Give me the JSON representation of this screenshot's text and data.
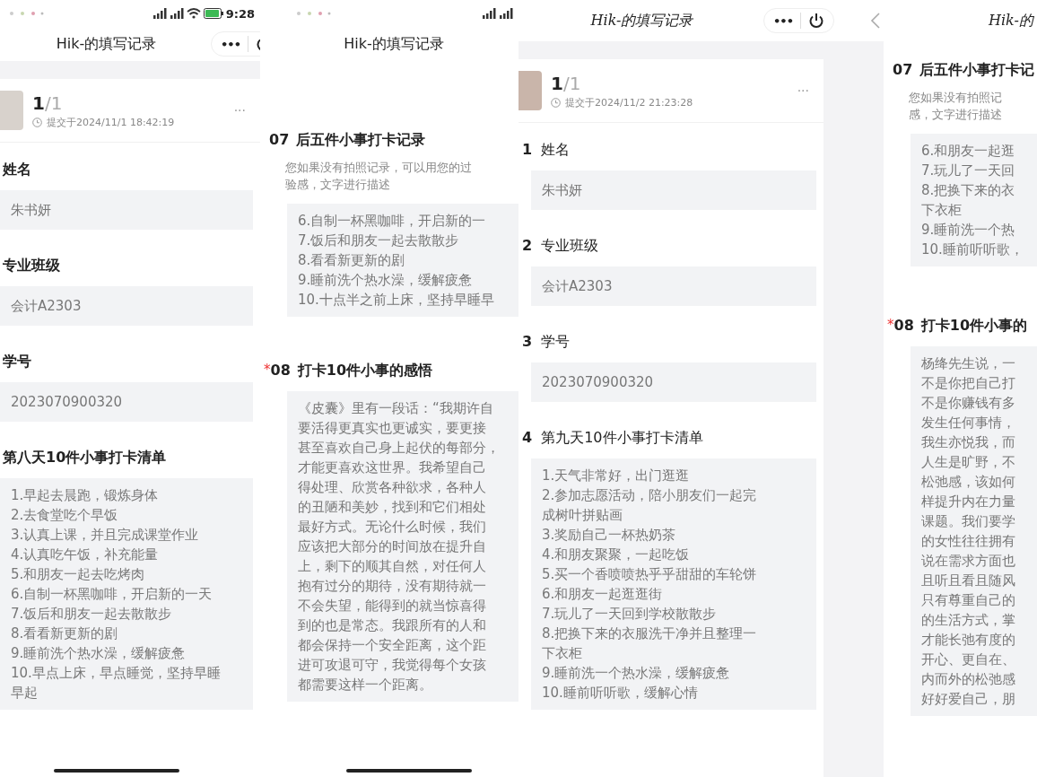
{
  "panels": [
    {
      "status_bar": {
        "kind": "full",
        "time": "9:28"
      },
      "nav": {
        "title": "Hik-的填写记录",
        "menu": "•••",
        "power": true
      },
      "header": {
        "index": "1",
        "total": "/1",
        "submitted": "提交于2024/11/1 18:42:19",
        "more": "···"
      },
      "home_indicator": true,
      "questions": [
        {
          "kind": "field",
          "label": "姓名",
          "answer": [
            "朱书妍"
          ]
        },
        {
          "kind": "field",
          "label": "专业班级",
          "answer": [
            "会计A2303"
          ]
        },
        {
          "kind": "field",
          "label": "学号",
          "answer": [
            "2023070900320"
          ]
        },
        {
          "kind": "list",
          "label": "第八天10件小事打卡清单",
          "answer": [
            "1.早起去晨跑，锻炼身体",
            "2.去食堂吃个早饭",
            "3.认真上课，并且完成课堂作业",
            "4.认真吃午饭，补充能量",
            "5.和朋友一起去吃烤肉",
            "6.自制一杯黑咖啡，开启新的一天",
            "7.饭后和朋友一起去散散步",
            "8.看看新更新的剧",
            "9.睡前洗个热水澡，缓解疲惫",
            "10.早点上床，早点睡觉，坚持早睡",
            "早起"
          ]
        }
      ]
    },
    {
      "status_bar": {
        "kind": "partial"
      },
      "nav": {
        "title": "Hik-的填写记录"
      },
      "home_indicator": true,
      "questions": [
        {
          "kind": "list",
          "number": "07",
          "label": "后五件小事打卡记录",
          "description": [
            "您如果没有拍照记录，可以用您的过",
            "验感，文字进行描述"
          ],
          "answer": [
            "6.自制一杯黑咖啡，开启新的一",
            "7.饭后和朋友一起去散散步",
            "8.看看新更新的剧",
            "9.睡前洗个热水澡，缓解疲惫",
            "10.十点半之前上床，坚持早睡早"
          ]
        },
        {
          "kind": "list",
          "mark": "*",
          "number": "08",
          "label": "打卡10件小事的感悟",
          "answer": [
            "《皮囊》里有一段话：“我期许自",
            "要活得更真实也更诚实，要更接",
            "甚至喜欢自己身上起伏的每部分，",
            "才能更喜欢这世界。我希望自己",
            "得处理、欣赏各种欲求，各种人",
            "的丑陋和美妙，找到和它们相处",
            "最好方式。无论什么时候，我们",
            "应该把大部分的时间放在提升自",
            "上，剩下的顺其自然，对任何人",
            "抱有过分的期待，没有期待就一",
            "不会失望，能得到的就当惊喜得",
            "到的也是常态。我跟所有的人和",
            "都会保持一个安全距离，这个距",
            "进可攻退可守，我觉得每个女孩",
            "都需要这样一个距离。"
          ]
        }
      ]
    },
    {
      "nav": {
        "title": "Hik-的填写记录",
        "menu": "•••",
        "power": true
      },
      "header": {
        "index": "1",
        "total": "/1",
        "submitted": "提交于2024/11/2 21:23:28",
        "more": "···"
      },
      "questions": [
        {
          "kind": "field",
          "number": "1",
          "label": "姓名",
          "answer": [
            "朱书妍"
          ]
        },
        {
          "kind": "field",
          "number": "2",
          "label": "专业班级",
          "answer": [
            "会计A2303"
          ]
        },
        {
          "kind": "field",
          "number": "3",
          "label": "学号",
          "answer": [
            "2023070900320"
          ]
        },
        {
          "kind": "list",
          "number": "4",
          "label": "第九天10件小事打卡清单",
          "answer": [
            "1.天气非常好，出门逛逛",
            "2.参加志愿活动，陪小朋友们一起完",
            "成树叶拼贴画",
            "3.奖励自己一杯热奶茶",
            "4.和朋友聚聚，一起吃饭",
            "5.买一个香喷喷热乎乎甜甜的车轮饼",
            "6.和朋友一起逛逛街",
            "7.玩儿了一天回到学校散散步",
            "8.把换下来的衣服洗干净并且整理一",
            "下衣柜",
            "9.睡前洗一个热水澡，缓解疲惫",
            "10.睡前听听歌，缓解心情"
          ]
        }
      ]
    },
    {
      "nav": {
        "back": true,
        "title": "Hik-的"
      },
      "questions": [
        {
          "kind": "list",
          "number": "07",
          "label": "后五件小事打卡记",
          "description": [
            "您如果没有拍照记",
            "感，文字进行描述"
          ],
          "answer": [
            "6.和朋友一起逛",
            "7.玩儿了一天回",
            "8.把换下来的衣",
            "下衣柜",
            "9.睡前洗一个热",
            "10.睡前听听歌，"
          ]
        },
        {
          "kind": "list",
          "mark": "*",
          "number": "08",
          "label": "打卡10件小事的",
          "answer": [
            "杨绛先生说，一",
            "不是你把自己打",
            "不是你赚钱有多",
            "发生任何事情，",
            "我生亦悦我，而",
            "人生是旷野，不",
            "松弛感，该如何",
            "样提升内在力量",
            "课题。我们要学",
            "的女性往往拥有",
            "说在需求方面也",
            "且听且看且随风",
            "只有尊重自己的",
            "的生活方式，掌",
            "才能长弛有度的",
            "开心、更自在、",
            "内而外的松弛感",
            "好好爱自己，朋"
          ]
        }
      ]
    }
  ]
}
